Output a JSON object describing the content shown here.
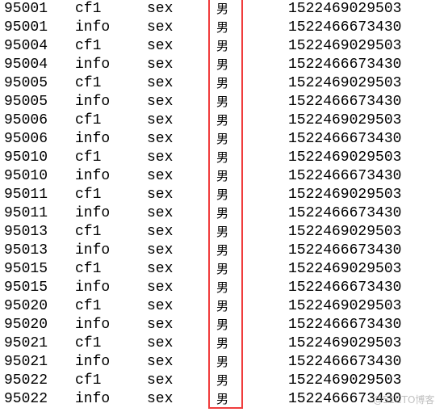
{
  "rows": [
    [
      "95001",
      "cf1",
      "sex",
      "男",
      "1522469029503"
    ],
    [
      "95001",
      "info",
      "sex",
      "男",
      "1522466673430"
    ],
    [
      "95004",
      "cf1",
      "sex",
      "男",
      "1522469029503"
    ],
    [
      "95004",
      "info",
      "sex",
      "男",
      "1522466673430"
    ],
    [
      "95005",
      "cf1",
      "sex",
      "男",
      "1522469029503"
    ],
    [
      "95005",
      "info",
      "sex",
      "男",
      "1522466673430"
    ],
    [
      "95006",
      "cf1",
      "sex",
      "男",
      "1522469029503"
    ],
    [
      "95006",
      "info",
      "sex",
      "男",
      "1522466673430"
    ],
    [
      "95010",
      "cf1",
      "sex",
      "男",
      "1522469029503"
    ],
    [
      "95010",
      "info",
      "sex",
      "男",
      "1522466673430"
    ],
    [
      "95011",
      "cf1",
      "sex",
      "男",
      "1522469029503"
    ],
    [
      "95011",
      "info",
      "sex",
      "男",
      "1522466673430"
    ],
    [
      "95013",
      "cf1",
      "sex",
      "男",
      "1522469029503"
    ],
    [
      "95013",
      "info",
      "sex",
      "男",
      "1522466673430"
    ],
    [
      "95015",
      "cf1",
      "sex",
      "男",
      "1522469029503"
    ],
    [
      "95015",
      "info",
      "sex",
      "男",
      "1522466673430"
    ],
    [
      "95020",
      "cf1",
      "sex",
      "男",
      "1522469029503"
    ],
    [
      "95020",
      "info",
      "sex",
      "男",
      "1522466673430"
    ],
    [
      "95021",
      "cf1",
      "sex",
      "男",
      "1522469029503"
    ],
    [
      "95021",
      "info",
      "sex",
      "男",
      "1522466673430"
    ],
    [
      "95022",
      "cf1",
      "sex",
      "男",
      "1522469029503"
    ],
    [
      "95022",
      "info",
      "sex",
      "男",
      "1522466673430"
    ]
  ],
  "highlight_color": "#f03c3c",
  "watermark": "@51CTO博客"
}
